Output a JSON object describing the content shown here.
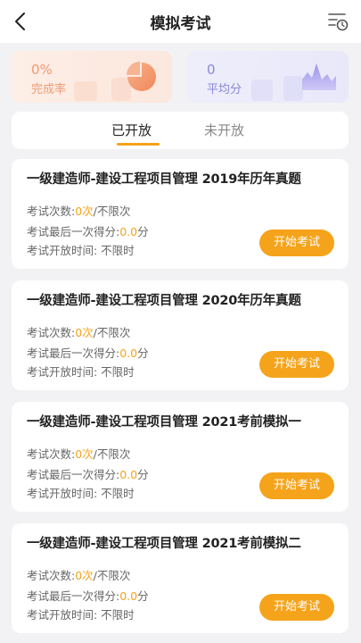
{
  "header": {
    "title": "模拟考试",
    "back_icon": "chevron-left-icon",
    "history_icon": "list-clock-icon"
  },
  "stats": {
    "completion": {
      "value": "0%",
      "label": "完成率",
      "icon": "pie-chart-icon",
      "color": "#ef9a74"
    },
    "average": {
      "value": "0",
      "label": "平均分",
      "icon": "area-chart-icon",
      "color": "#8c86d8"
    }
  },
  "tabs": [
    {
      "label": "已开放",
      "active": true
    },
    {
      "label": "未开放",
      "active": false
    }
  ],
  "accent": "#f5a31a",
  "exams": [
    {
      "title": "一级建造师-建设工程项目管理 2019年历年真题",
      "attempts_label": "考试次数:",
      "attempts_value": "0次",
      "attempts_suffix": "/不限次",
      "score_label": "考试最后一次得分:",
      "score_value": "0.0",
      "score_unit": "分",
      "time": "考试开放时间: 不限时",
      "button": "开始考试"
    },
    {
      "title": "一级建造师-建设工程项目管理 2020年历年真题",
      "attempts_label": "考试次数:",
      "attempts_value": "0次",
      "attempts_suffix": "/不限次",
      "score_label": "考试最后一次得分:",
      "score_value": "0.0",
      "score_unit": "分",
      "time": "考试开放时间: 不限时",
      "button": "开始考试"
    },
    {
      "title": "一级建造师-建设工程项目管理 2021考前模拟一",
      "attempts_label": "考试次数:",
      "attempts_value": "0次",
      "attempts_suffix": "/不限次",
      "score_label": "考试最后一次得分:",
      "score_value": "0.0",
      "score_unit": "分",
      "time": "考试开放时间: 不限时",
      "button": "开始考试"
    },
    {
      "title": "一级建造师-建设工程项目管理 2021考前模拟二",
      "attempts_label": "考试次数:",
      "attempts_value": "0次",
      "attempts_suffix": "/不限次",
      "score_label": "考试最后一次得分:",
      "score_value": "0.0",
      "score_unit": "分",
      "time": "考试开放时间: 不限时",
      "button": "开始考试"
    }
  ]
}
